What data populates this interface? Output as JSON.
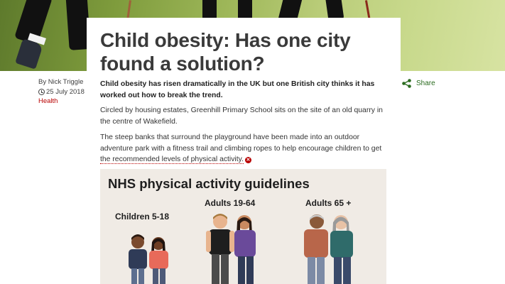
{
  "article": {
    "title": "Child obesity: Has one city found a solution?",
    "byline": {
      "author": "By Nick Triggle",
      "date": "25 July 2018",
      "topic": "Health"
    },
    "share_label": "Share",
    "lead": "Child obesity has risen dramatically in the UK but one British city thinks it has worked out how to break the trend.",
    "paragraphs": {
      "p1": "Circled by housing estates, Greenhill Primary School sits on the site of an old quarry in the centre of Wakefield.",
      "p2_text": "The steep banks that surround the playground have been made into an outdoor adventure park with a fitness trail and climbing ropes to help encourage children to get ",
      "p2_link": "the recommended levels of physical activity."
    }
  },
  "infographic": {
    "title": "NHS physical activity guidelines",
    "groups": {
      "children": "Children 5-18",
      "adults": "Adults 19-64",
      "older": "Adults 65 +"
    }
  },
  "icons": [
    "clock-icon",
    "share-icon",
    "external-link-icon"
  ],
  "colors": {
    "accent_red": "#b80000",
    "share_green": "#2a6b1f",
    "infographic_bg": "#f0ebe5"
  }
}
